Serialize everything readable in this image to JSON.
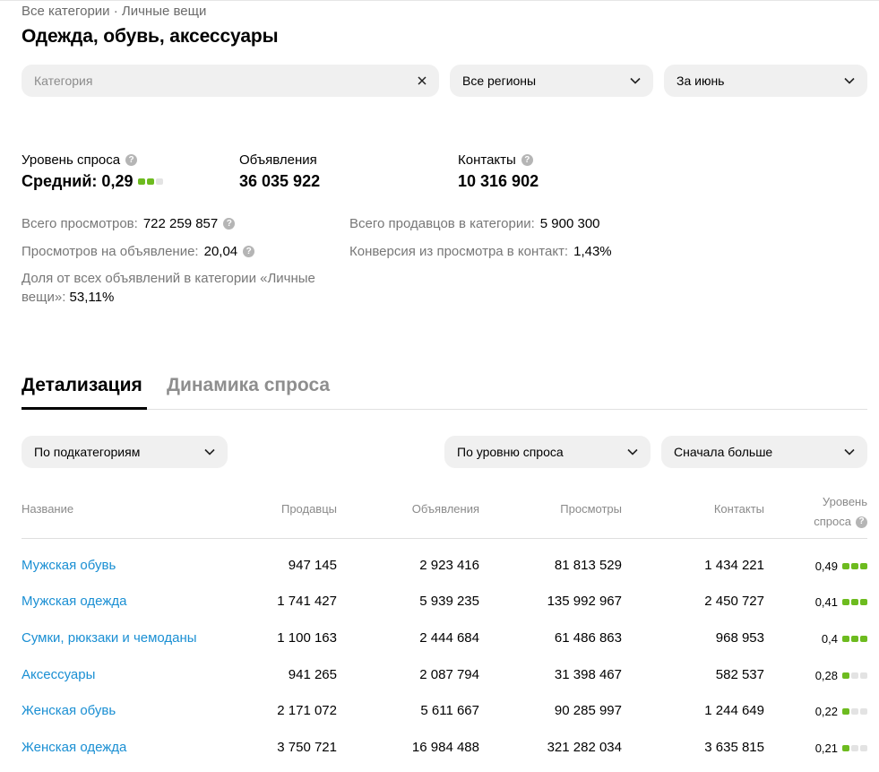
{
  "breadcrumb": "Все категории · Личные вещи",
  "title": "Одежда, обувь, аксессуары",
  "filters": {
    "category_placeholder": "Категория",
    "region": "Все регионы",
    "period": "За июнь"
  },
  "metrics": {
    "demand_label": "Уровень спроса",
    "demand_value": "Средний: 0,29",
    "demand_dots": 2,
    "ads_label": "Объявления",
    "ads_value": "36 035 922",
    "contacts_label": "Контакты",
    "contacts_value": "10 316 902"
  },
  "stats": {
    "views_label": "Всего просмотров:",
    "views_value": "722 259 857",
    "views_per_ad_label": "Просмотров на объявление:",
    "views_per_ad_value": "20,04",
    "share_label": "Доля от всех объявлений в категории «Личные вещи»:",
    "share_value": "53,11%",
    "sellers_label": "Всего продавцов в категории:",
    "sellers_value": "5 900 300",
    "conversion_label": "Конверсия из просмотра в контакт:",
    "conversion_value": "1,43%"
  },
  "tabs": {
    "details": "Детализация",
    "dynamics": "Динамика спроса"
  },
  "table_controls": {
    "group_by": "По подкатегориям",
    "sort_by": "По уровню спроса",
    "order": "Сначала больше"
  },
  "table": {
    "headers": {
      "name": "Название",
      "sellers": "Продавцы",
      "ads": "Объявления",
      "views": "Просмотры",
      "contacts": "Контакты",
      "level_line1": "Уровень",
      "level_line2": "спроса"
    },
    "rows": [
      {
        "name": "Мужская обувь",
        "sellers": "947 145",
        "ads": "2 923 416",
        "views": "81 813 529",
        "contacts": "1 434 221",
        "level": "0,49",
        "dots": 3
      },
      {
        "name": "Мужская одежда",
        "sellers": "1 741 427",
        "ads": "5 939 235",
        "views": "135 992 967",
        "contacts": "2 450 727",
        "level": "0,41",
        "dots": 3
      },
      {
        "name": "Сумки, рюкзаки и чемоданы",
        "sellers": "1 100 163",
        "ads": "2 444 684",
        "views": "61 486 863",
        "contacts": "968 953",
        "level": "0,4",
        "dots": 3
      },
      {
        "name": "Аксессуары",
        "sellers": "941 265",
        "ads": "2 087 794",
        "views": "31 398 467",
        "contacts": "582 537",
        "level": "0,28",
        "dots": 1
      },
      {
        "name": "Женская обувь",
        "sellers": "2 171 072",
        "ads": "5 611 667",
        "views": "90 285 997",
        "contacts": "1 244 649",
        "level": "0,22",
        "dots": 1
      },
      {
        "name": "Женская одежда",
        "sellers": "3 750 721",
        "ads": "16 984 488",
        "views": "321 282 034",
        "contacts": "3 635 815",
        "level": "0,21",
        "dots": 1
      }
    ]
  },
  "colors": {
    "link": "#1a8fd3",
    "level_active": "#6dbb1f",
    "level_inactive": "#e3e3e3"
  }
}
